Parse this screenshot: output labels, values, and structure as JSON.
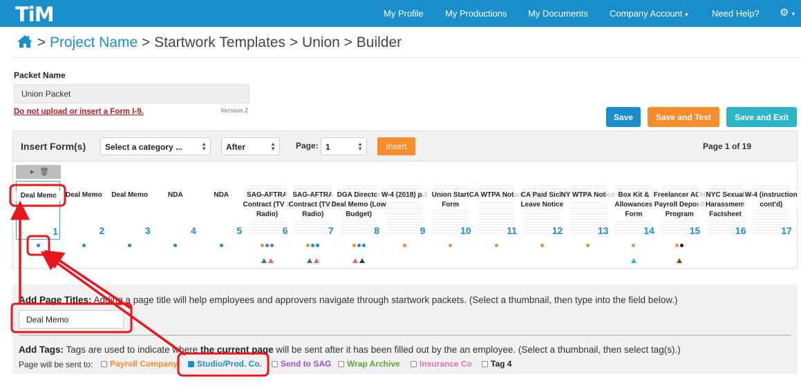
{
  "nav": {
    "logo": "TiM",
    "items": [
      "My Profile",
      "My Productions",
      "My Documents",
      "Company Account",
      "Need Help?"
    ],
    "caret": "▾",
    "gear": "⚙"
  },
  "breadcrumb": {
    "sep": ">",
    "project": "Project Name",
    "templates": "Startwork Templates",
    "union": "Union",
    "builder": "Builder"
  },
  "packet": {
    "label": "Packet Name",
    "value": "Union Packet",
    "warning": "Do not upload or insert a Form I-9.",
    "version": "Version 2"
  },
  "actions": {
    "save": "Save",
    "save_test": "Save and Test",
    "save_exit": "Save and Exit"
  },
  "insert": {
    "title": "Insert Form(s)",
    "category": "Select a category ...",
    "position": "After",
    "page_label": "Page:",
    "page_value": "1",
    "insert_btn": "Insert",
    "page_of": "Page 1 of 19"
  },
  "thumbnails": [
    {
      "title": "Deal Memo",
      "num": "1",
      "dots": [
        "#1a8ecb"
      ],
      "tris": []
    },
    {
      "title": "Deal Memo",
      "num": "2",
      "dots": [
        "#1a8ecb"
      ],
      "tris": []
    },
    {
      "title": "Deal Memo",
      "num": "3",
      "dots": [
        "#1a8ecb"
      ],
      "tris": []
    },
    {
      "title": "NDA",
      "num": "4",
      "dots": [
        "#1a8ecb"
      ],
      "tris": []
    },
    {
      "title": "NDA",
      "num": "5",
      "dots": [
        "#1a8ecb"
      ],
      "tris": []
    },
    {
      "title": "SAG-AFTRA Contract (TV & Radio)",
      "num": "6",
      "dots": [
        "#f68c2b",
        "#1a8ecb",
        "#9b51e0"
      ],
      "tris": [
        "#2e8b3a",
        "#e8607a"
      ]
    },
    {
      "title": "SAG-AFTRA Contract (TV & Radio)",
      "num": "7",
      "dots": [
        "#f68c2b",
        "#1a8ecb",
        "#1a8ecb"
      ],
      "tris": [
        "#2e8b3a",
        "#e8607a"
      ]
    },
    {
      "title": "DGA Director Deal Memo (Low Budget)",
      "num": "8",
      "dots": [
        "#f68c2b",
        "#1a8ecb",
        "#1a8ecb"
      ],
      "tris": [
        "#e8607a",
        "#1f3f7a"
      ]
    },
    {
      "title": "W-4 (2018) p.1",
      "num": "9",
      "dots": [
        "#f68c2b"
      ],
      "tris": []
    },
    {
      "title": "Union Start Form",
      "num": "10",
      "dots": [
        "#f68c2b"
      ],
      "tris": []
    },
    {
      "title": "CA WTPA Notice",
      "num": "11",
      "dots": [
        "#f68c2b"
      ],
      "tris": []
    },
    {
      "title": "CA Paid Sick Leave Notice",
      "num": "12",
      "dots": [
        "#f68c2b"
      ],
      "tris": []
    },
    {
      "title": "NY WTPA Notice",
      "num": "13",
      "dots": [
        "#f68c2b"
      ],
      "tris": []
    },
    {
      "title": "Box Kit & Allowances Form",
      "num": "14",
      "dots": [
        "#f68c2b"
      ],
      "tris": [
        "#2bb5c6"
      ]
    },
    {
      "title": "Freelancer ACH Payroll Deposit Program",
      "num": "15",
      "dots": [
        "#f68c2b",
        "#111111"
      ],
      "tris": [
        "#8b4513"
      ]
    },
    {
      "title": "NYC Sexual Harassment Factsheet",
      "num": "16",
      "dots": [],
      "tris": []
    },
    {
      "title": "W-4 (instruction cont'd)",
      "num": "17",
      "dots": [],
      "tris": []
    }
  ],
  "page_titles": {
    "label": "Add Page Titles:",
    "desc": " Adding a page title will help employees and approvers navigate through startwork packets. (Select a thumbnail, then type into the field below.)",
    "value": "Deal Memo"
  },
  "tags": {
    "label": "Add Tags:",
    "desc_a": " Tags are used to indicate where ",
    "desc_b": "the current page",
    "desc_c": " will be sent after it has been filled out by the an employee. (Select a thumbnail, then select tag(s).)",
    "sent_to": "Page will be sent to:",
    "items": [
      {
        "label": "Payroll Company",
        "color": "#f68c2b",
        "checked": false
      },
      {
        "label": "Studio/Prod. Co.",
        "color": "#1a8ecb",
        "checked": true
      },
      {
        "label": "Send to SAG",
        "color": "#9b51e0",
        "checked": false
      },
      {
        "label": "Wrap Archive",
        "color": "#5aa832",
        "checked": false
      },
      {
        "label": "Insurance Co",
        "color": "#e86fb6",
        "checked": false
      },
      {
        "label": "Tag 4",
        "color": "#222222",
        "checked": false
      }
    ]
  },
  "colors": {
    "primary": "#1a8ecb",
    "orange": "#f68c2b",
    "teal": "#2bb5c6",
    "annotation": "#e8161c"
  }
}
